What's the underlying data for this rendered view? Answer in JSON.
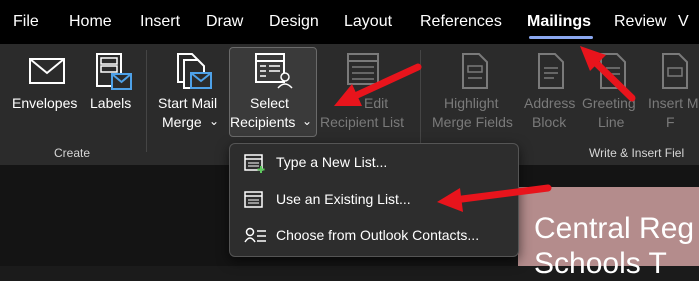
{
  "tabs": [
    {
      "label": "File"
    },
    {
      "label": "Home"
    },
    {
      "label": "Insert"
    },
    {
      "label": "Draw"
    },
    {
      "label": "Design"
    },
    {
      "label": "Layout"
    },
    {
      "label": "References"
    },
    {
      "label": "Mailings",
      "active": true
    },
    {
      "label": "Review"
    },
    {
      "label": "V"
    }
  ],
  "ribbon": {
    "create_group": "Create",
    "write_group": "Write & Insert Fiel",
    "envelopes": "Envelopes",
    "labels": "Labels",
    "start_mail_merge_1": "Start Mail",
    "start_mail_merge_2": "Merge",
    "select_recipients_1": "Select",
    "select_recipients_2": "Recipients",
    "edit_recipient_1": "Edit",
    "edit_recipient_2": "Recipient List",
    "highlight_1": "Highlight",
    "highlight_2": "Merge Fields",
    "address_1": "Address",
    "address_2": "Block",
    "greeting_1": "Greeting",
    "greeting_2": "Line",
    "insert_merge_1": "Insert M",
    "insert_merge_2": "F"
  },
  "dropdown": {
    "items": [
      {
        "label": "Type a New List..."
      },
      {
        "label": "Use an Existing List..."
      },
      {
        "label": "Choose from Outlook Contacts..."
      }
    ]
  },
  "document": {
    "title_line1": "Central Reg",
    "title_line2": "Schools T"
  },
  "colors": {
    "accent_underline": "#8aa7ef",
    "arrow": "#e8141c",
    "slide_bg": "#b48c8c"
  }
}
